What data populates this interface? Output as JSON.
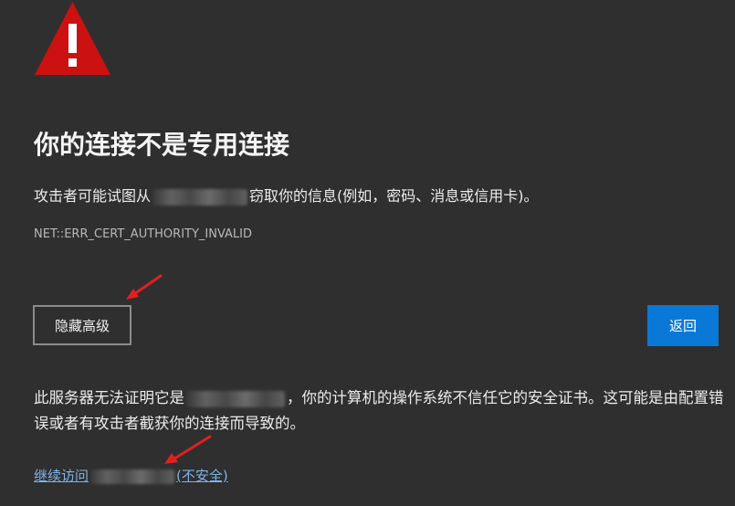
{
  "icon": "warning-triangle-icon",
  "colors": {
    "background": "#2f2f2f",
    "warning_red": "#cc1111",
    "primary_blue": "#0a78d7",
    "link": "#7fb3e8",
    "arrow_red": "#e02020"
  },
  "title": "你的连接不是专用连接",
  "description": {
    "before": "攻击者可能试图从",
    "after": "窃取你的信息(例如，密码、消息或信用卡)。"
  },
  "error_code": "NET::ERR_CERT_AUTHORITY_INVALID",
  "buttons": {
    "hide_advanced": "隐藏高级",
    "back": "返回"
  },
  "details": {
    "before": "此服务器无法证明它是",
    "after": "，你的计算机的操作系统不信任它的安全证书。这可能是由配置错误或者有攻击者截获你的连接而导致的。"
  },
  "proceed": {
    "before": "继续访问",
    "after": "(不安全)"
  }
}
